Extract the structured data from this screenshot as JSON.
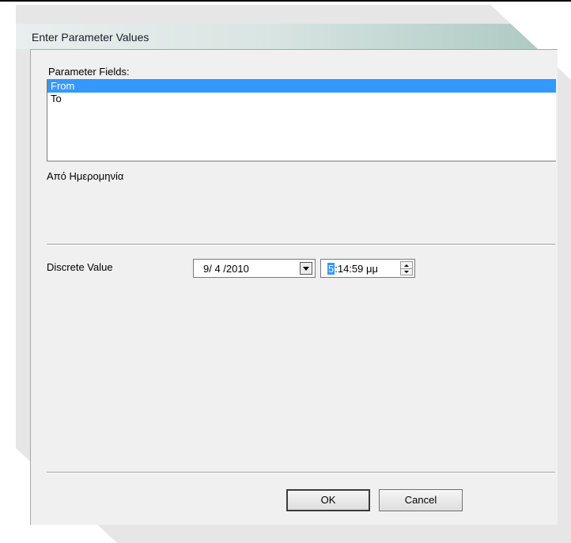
{
  "window": {
    "title": "Enter Parameter Values"
  },
  "parameters": {
    "label": "Parameter Fields:",
    "items": [
      {
        "label": "From",
        "selected": true
      },
      {
        "label": "To",
        "selected": false
      }
    ],
    "description": "Από Ημερομηνία"
  },
  "value": {
    "label": "Discrete Value",
    "date": "9/ 4 /2010",
    "time_selected": "5",
    "time_rest": ":14:59 μμ"
  },
  "buttons": {
    "ok": "OK",
    "cancel": "Cancel"
  },
  "colors": {
    "selection": "#3399ff",
    "titlebar_end": "#a9c7bf"
  }
}
